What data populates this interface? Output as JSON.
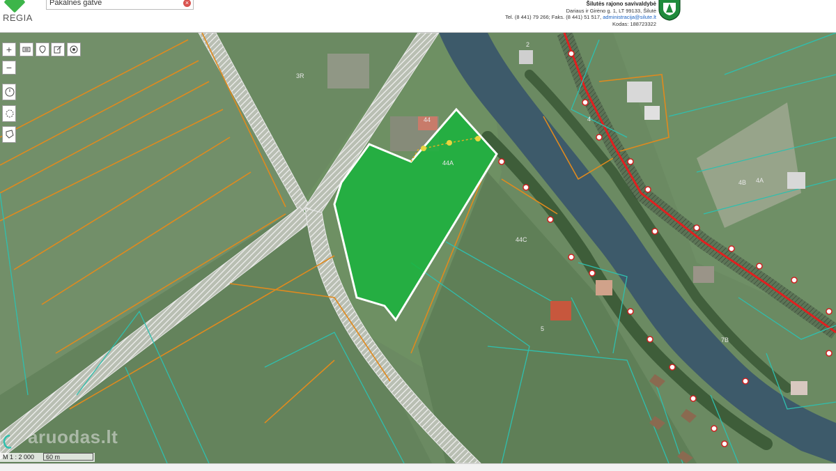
{
  "app": {
    "logo_text": "REGIA"
  },
  "search": {
    "value": "Pakalnės gatvė"
  },
  "org": {
    "title": "Šilutės rajono savivaldybė",
    "address": "Dariaus ir Girėno g. 1, LT 99133, Šilutė",
    "phone_prefix": "Tel. (8 441) 79 266; Faks. (8 441) 51 517,",
    "email": "administracija@silute.lt",
    "code": "Kodas: 188723322"
  },
  "toolbar": {
    "zoom_in": "+",
    "zoom_out": "−"
  },
  "map": {
    "parcel_labels": [
      "44A",
      "44C",
      "44",
      "3R",
      "4B",
      "4A",
      "4",
      "7B",
      "5",
      "2"
    ],
    "colors": {
      "parcel_fill": "#19b43c",
      "road_hatch": "#e8e8e8",
      "boundary_orange": "#e08a1e",
      "boundary_teal": "#2fbfae",
      "railway": "#e02020",
      "river": "#3d5a6a"
    }
  },
  "scale": {
    "ratio": "M 1 : 2 000",
    "length": "60 m"
  },
  "watermark": "aruodas.lt"
}
